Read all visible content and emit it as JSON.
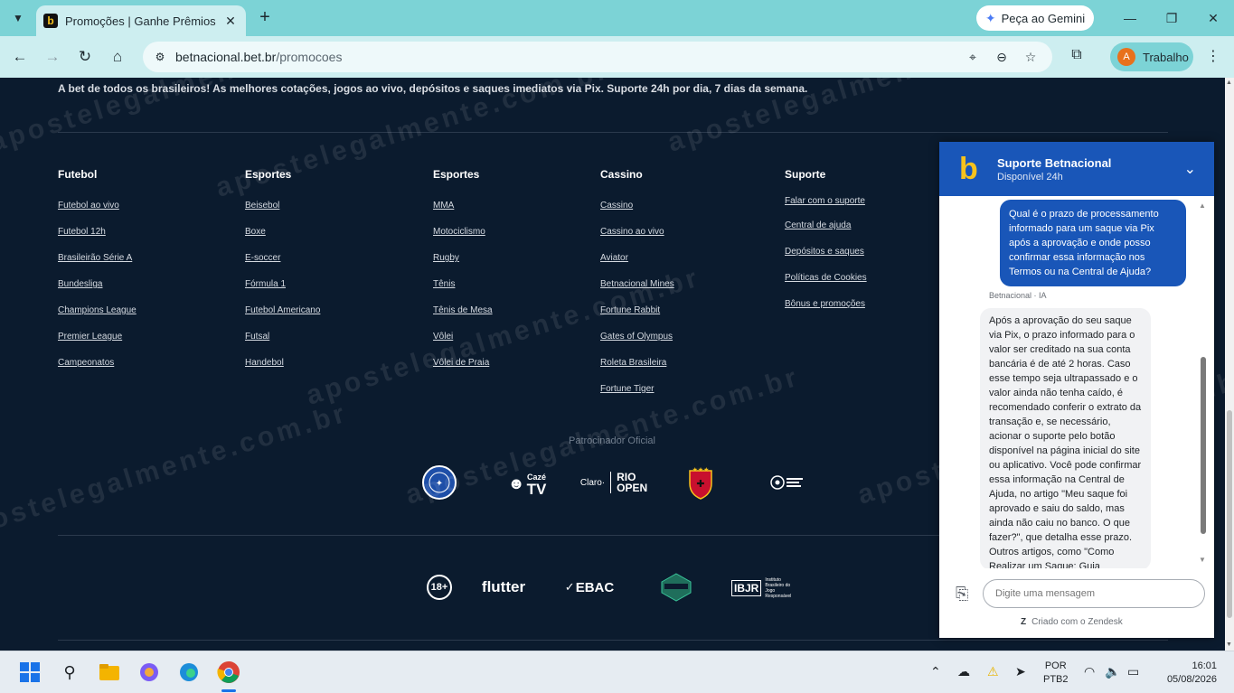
{
  "browser": {
    "tab_title": "Promoções | Ganhe Prêmios e B",
    "tab_close": "✕",
    "new_tab": "+",
    "gemini_label": "Peça ao Gemini",
    "url_host": "betnacional.bet.br",
    "url_path": "/promocoes",
    "profile_initial": "A",
    "profile_name": "Trabalho"
  },
  "page": {
    "tagline": "A bet de todos os brasileiros! As melhores cotações, jogos ao vivo, depósitos e saques imediatos via Pix. Suporte 24h por dia, 7 dias da semana.",
    "columns": [
      {
        "title": "Futebol",
        "links": [
          "Futebol ao vivo",
          "Futebol 12h",
          "Brasileirão Série A",
          "Bundesliga",
          "Champions League",
          "Premier League",
          "Campeonatos"
        ]
      },
      {
        "title": "Esportes",
        "links": [
          "Beisebol",
          "Boxe",
          "E-soccer",
          "Fórmula 1",
          "Futebol Americano",
          "Futsal",
          "Handebol"
        ]
      },
      {
        "title": "Esportes",
        "links": [
          "MMA",
          "Motociclismo",
          "Rugby",
          "Tênis",
          "Tênis de Mesa",
          "Vôlei",
          "Vôlei de Praia"
        ]
      },
      {
        "title": "Cassino",
        "links": [
          "Cassino",
          "Cassino ao vivo",
          "Aviator",
          "Betnacional Mines",
          "Fortune Rabbit",
          "Gates of Olympus",
          "Roleta Brasileira",
          "Fortune Tiger"
        ]
      },
      {
        "title": "Suporte",
        "links": [
          "Falar com o suporte",
          "Central de ajuda",
          "Depósitos e saques",
          "Políticas de Cookies",
          "Bônus e promoções"
        ]
      }
    ],
    "sponsor_label": "Patrocinador Oficial",
    "sponsors": {
      "caze_top": "Cazé",
      "caze_bottom": "TV",
      "claro": "Claro·",
      "rio_top": "RIO",
      "rio_bottom": "OPEN"
    },
    "bottom_logos": {
      "age": "18+",
      "flutter": "flutter",
      "ebac": "EBAC",
      "ibjr": "IBJR",
      "ibjr_sub": "Instituto Brasileiro do Jogo Responsável"
    },
    "watermark": "apostelegalmente.com.br"
  },
  "chat": {
    "title": "Suporte Betnacional",
    "subtitle": "Disponível 24h",
    "user_message": "Qual é o prazo de processamento informado para um saque via Pix após a aprovação e onde posso confirmar essa informação nos Termos ou na Central de Ajuda?",
    "bot_name": "Betnacional · IA",
    "bot_message": "Após a aprovação do seu saque via Pix, o prazo informado para o valor ser creditado na sua conta bancária é de até 2 horas. Caso esse tempo seja ultrapassado e o valor ainda não tenha caído, é recomendado conferir o extrato da transação e, se necessário, acionar o suporte pelo botão disponível na página inicial do site ou aplicativo. Você pode confirmar essa informação na Central de Ajuda, no artigo \"Meu saque foi aprovado e saiu do saldo, mas ainda não caiu no banco. O que fazer?\", que detalha esse prazo. Outros artigos, como \"Como Realizar um Saque: Guia",
    "input_placeholder": "Digite uma mensagem",
    "footer": "Criado com o Zendesk"
  },
  "taskbar": {
    "lang_top": "POR",
    "lang_bottom": "PTB2",
    "time": "16:01",
    "date": "05/08/2026"
  }
}
